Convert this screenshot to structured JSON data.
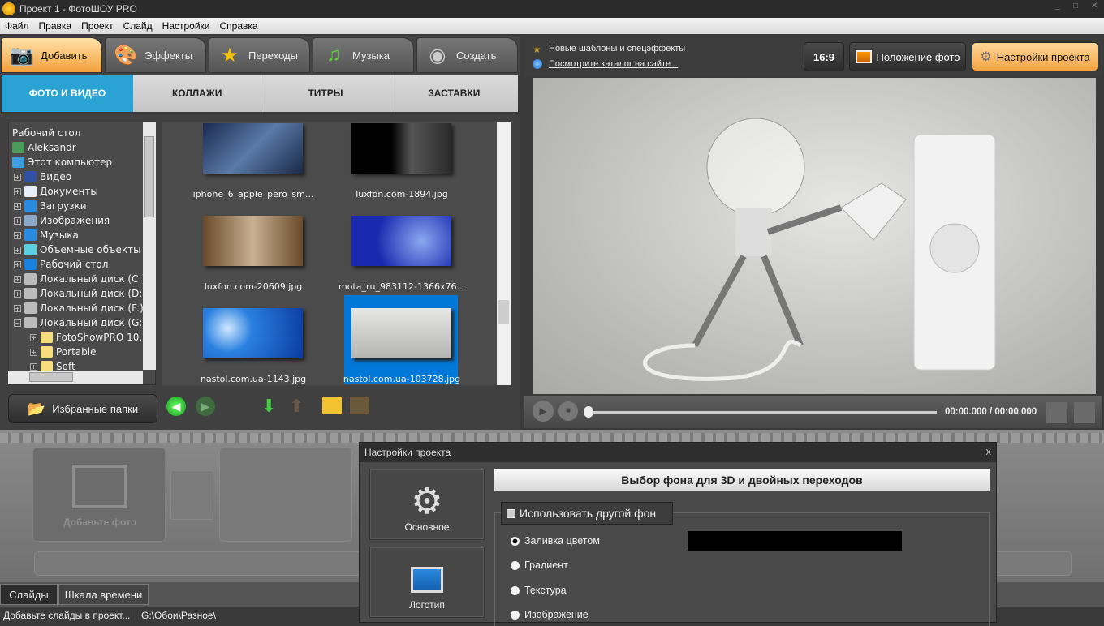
{
  "window": {
    "title": "Проект 1 - ФотоШОУ PRO",
    "min": "_",
    "max": "□",
    "close": "✕"
  },
  "menu": [
    "Файл",
    "Правка",
    "Проект",
    "Слайд",
    "Настройки",
    "Справка"
  ],
  "main_tabs": [
    {
      "label": "Добавить",
      "icon": "camera-icon"
    },
    {
      "label": "Эффекты",
      "icon": "palette-icon"
    },
    {
      "label": "Переходы",
      "icon": "star-icon"
    },
    {
      "label": "Музыка",
      "icon": "music-note-icon"
    },
    {
      "label": "Создать",
      "icon": "film-reel-icon"
    }
  ],
  "sub_tabs": [
    "ФОТО И ВИДЕО",
    "КОЛЛАЖИ",
    "ТИТРЫ",
    "ЗАСТАВКИ"
  ],
  "tree": [
    {
      "label": "Рабочий стол",
      "level": 0,
      "expander": ""
    },
    {
      "label": "Aleksandr",
      "level": 0,
      "expander": "",
      "icon": "user-icon"
    },
    {
      "label": "Этот компьютер",
      "level": 0,
      "expander": "",
      "icon": "computer-icon"
    },
    {
      "label": "Видео",
      "level": 1,
      "expander": "+",
      "icon": "video-icon"
    },
    {
      "label": "Документы",
      "level": 1,
      "expander": "+",
      "icon": "documents-icon"
    },
    {
      "label": "Загрузки",
      "level": 1,
      "expander": "+",
      "icon": "download-icon"
    },
    {
      "label": "Изображения",
      "level": 1,
      "expander": "+",
      "icon": "pictures-icon"
    },
    {
      "label": "Музыка",
      "level": 1,
      "expander": "+",
      "icon": "music-icon"
    },
    {
      "label": "Объемные объекты",
      "level": 1,
      "expander": "+",
      "icon": "cube-icon"
    },
    {
      "label": "Рабочий стол",
      "level": 1,
      "expander": "+",
      "icon": "desktop-icon"
    },
    {
      "label": "Локальный диск (C:)",
      "level": 1,
      "expander": "+",
      "icon": "drive-icon"
    },
    {
      "label": "Локальный диск (D:)",
      "level": 1,
      "expander": "+",
      "icon": "drive-icon"
    },
    {
      "label": "Локальный диск (F:)",
      "level": 1,
      "expander": "+",
      "icon": "drive-icon"
    },
    {
      "label": "Локальный диск (G:)",
      "level": 1,
      "expander": "−",
      "icon": "drive-icon"
    },
    {
      "label": "FotoShowPRO 10.",
      "level": 2,
      "expander": "+",
      "icon": "folder-icon"
    },
    {
      "label": "Portable",
      "level": 2,
      "expander": "+",
      "icon": "folder-icon"
    },
    {
      "label": "Soft",
      "level": 2,
      "expander": "+",
      "icon": "folder-icon"
    }
  ],
  "files": [
    {
      "name": "iphone_6_apple_pero_sm...",
      "selected": false
    },
    {
      "name": "luxfon.com-1894.jpg",
      "selected": false
    },
    {
      "name": "luxfon.com-20609.jpg",
      "selected": false
    },
    {
      "name": "mota_ru_983112-1366x76...",
      "selected": false
    },
    {
      "name": "nastol.com.ua-1143.jpg",
      "selected": false
    },
    {
      "name": "nastol.com.ua-103728.jpg",
      "selected": true
    }
  ],
  "favorites_label": "Избранные папки",
  "promo": {
    "line1": "Новые шаблоны и спецэффекты",
    "link": "Посмотрите каталог на сайте..."
  },
  "toolbar": {
    "ratio": "16:9",
    "photo_position": "Положение фото",
    "project_settings": "Настройки проекта"
  },
  "player": {
    "time": "00:00.000 / 00:00.000",
    "progress": 0
  },
  "timeline": {
    "add_photo": "Добавьте фото"
  },
  "bottom_tabs": [
    "Слайды",
    "Шкала времени"
  ],
  "status": {
    "left": "Добавьте слайды в проект...",
    "path": "G:\\Обои\\Разное\\"
  },
  "dialog": {
    "title": "Настройки проекта",
    "close": "x",
    "side": [
      "Основное",
      "Логотип"
    ],
    "header": "Выбор фона для 3D и двойных переходов",
    "use_other_bg": "Использовать другой фон",
    "use_other_bg_checked": false,
    "options": [
      "Заливка цветом",
      "Градиент",
      "Текстура",
      "Изображение"
    ],
    "selected_option": 0,
    "fill_color": "#000000"
  },
  "colors": {
    "accent_blue": "#2aa3d4",
    "active_tab": "#f3a03c",
    "selection": "#0078d7"
  }
}
